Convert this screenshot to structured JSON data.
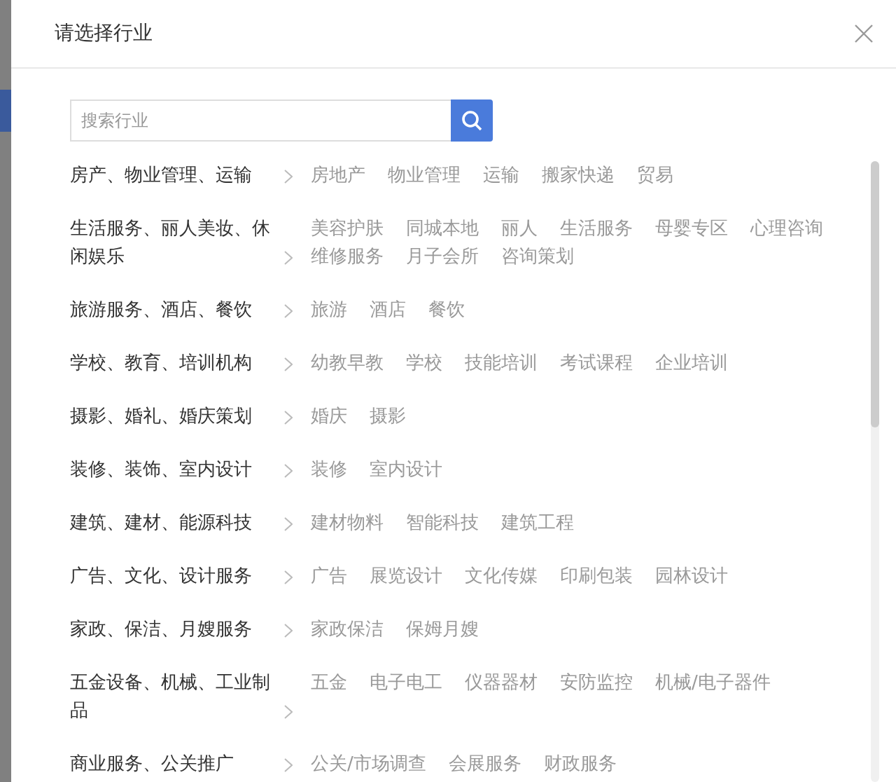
{
  "dialog": {
    "title": "请选择行业"
  },
  "search": {
    "placeholder": "搜索行业"
  },
  "categories": [
    {
      "name": "房产、物业管理、运输",
      "items": [
        "房地产",
        "物业管理",
        "运输",
        "搬家快递",
        "贸易"
      ]
    },
    {
      "name": "生活服务、丽人美妆、休闲娱乐",
      "items": [
        "美容护肤",
        "同城本地",
        "丽人",
        "生活服务",
        "母婴专区",
        "心理咨询",
        "维修服务",
        "月子会所",
        "咨询策划"
      ]
    },
    {
      "name": "旅游服务、酒店、餐饮",
      "items": [
        "旅游",
        "酒店",
        "餐饮"
      ]
    },
    {
      "name": "学校、教育、培训机构",
      "items": [
        "幼教早教",
        "学校",
        "技能培训",
        "考试课程",
        "企业培训"
      ]
    },
    {
      "name": "摄影、婚礼、婚庆策划",
      "items": [
        "婚庆",
        "摄影"
      ]
    },
    {
      "name": "装修、装饰、室内设计",
      "items": [
        "装修",
        "室内设计"
      ]
    },
    {
      "name": "建筑、建材、能源科技",
      "items": [
        "建材物料",
        "智能科技",
        "建筑工程"
      ]
    },
    {
      "name": "广告、文化、设计服务",
      "items": [
        "广告",
        "展览设计",
        "文化传媒",
        "印刷包装",
        "园林设计"
      ]
    },
    {
      "name": "家政、保洁、月嫂服务",
      "items": [
        "家政保洁",
        "保姆月嫂"
      ]
    },
    {
      "name": "五金设备、机械、工业制品",
      "items": [
        "五金",
        "电子电工",
        "仪器器材",
        "安防监控",
        "机械/电子器件"
      ]
    },
    {
      "name": "商业服务、公关推广",
      "items": [
        "公关/市场调查",
        "会展服务",
        "财政服务"
      ]
    }
  ]
}
